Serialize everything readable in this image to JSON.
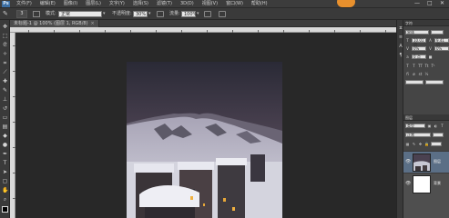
{
  "app": {
    "logo": "Ps"
  },
  "menu": {
    "items": [
      "文件(F)",
      "编辑(E)",
      "图像(I)",
      "图层(L)",
      "文字(Y)",
      "选择(S)",
      "滤镜(T)",
      "3D(D)",
      "视图(V)",
      "窗口(W)",
      "帮助(H)"
    ],
    "window_controls": [
      "—",
      "□",
      "✕"
    ]
  },
  "options": {
    "brush_size": "3",
    "mode_label": "模式:",
    "mode_value": "正常",
    "opacity_label": "不透明度:",
    "opacity_value": "30%",
    "flow_label": "流量:",
    "flow_value": "100%"
  },
  "document": {
    "tab_title": "未标题-1 @ 100% (图层 1, RGB/8)",
    "tab_close": "×"
  },
  "panels": {
    "character_header": "字符",
    "font_name": "宋体",
    "font_size": "10.01 点",
    "leading": "9.41 点",
    "tracking": "0%",
    "kerning": "0%",
    "baseline": "0 点",
    "layers_header": "图层",
    "blend_mode": "正常",
    "layer_kind": "类型",
    "layers": [
      {
        "name": "图层",
        "selected": true
      },
      {
        "name": "背景",
        "selected": false
      }
    ]
  },
  "colors": {
    "accent": "#e8902d",
    "selected_layer": "#5b6f86"
  },
  "icons": {
    "toolbar": [
      "move-icon",
      "marquee-icon",
      "lasso-icon",
      "quick-select-icon",
      "crop-icon",
      "eyedropper-icon",
      "healing-icon",
      "brush-icon",
      "stamp-icon",
      "history-brush-icon",
      "eraser-icon",
      "gradient-icon",
      "blur-icon",
      "dodge-icon",
      "pen-icon",
      "type-icon",
      "path-select-icon",
      "shape-icon",
      "hand-icon",
      "zoom-icon"
    ]
  }
}
